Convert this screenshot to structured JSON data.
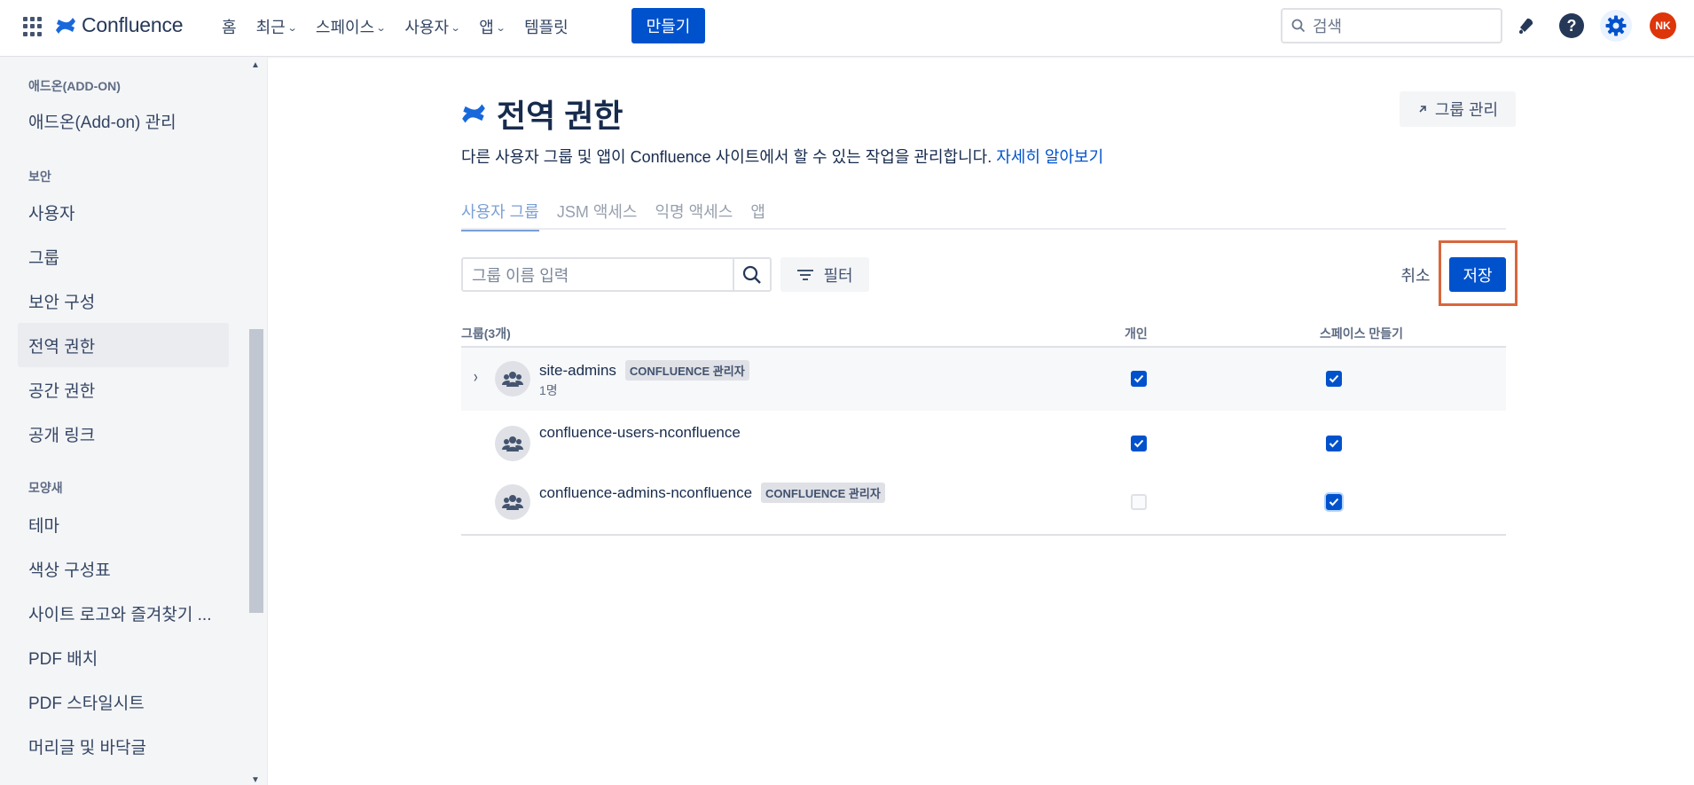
{
  "topnav": {
    "logo_text": "Confluence",
    "items": [
      {
        "label": "홈",
        "dropdown": false
      },
      {
        "label": "최근",
        "dropdown": true
      },
      {
        "label": "스페이스",
        "dropdown": true
      },
      {
        "label": "사용자",
        "dropdown": true
      },
      {
        "label": "앱",
        "dropdown": true
      },
      {
        "label": "템플릿",
        "dropdown": false
      }
    ],
    "create_label": "만들기",
    "search_placeholder": "검색",
    "avatar_initials": "NK"
  },
  "sidebar": {
    "sections": [
      {
        "title": "애드온(ADD-ON)",
        "items": [
          "애드온(Add-on) 관리"
        ]
      },
      {
        "title": "보안",
        "items": [
          "사용자",
          "그룹",
          "보안 구성",
          "전역 권한",
          "공간 권한",
          "공개 링크"
        ]
      },
      {
        "title": "모양새",
        "items": [
          "테마",
          "색상 구성표",
          "사이트 로고와 즐겨찾기 ...",
          "PDF 배치",
          "PDF 스타일시트",
          "머리글 및 바닥글"
        ]
      }
    ],
    "active_item": "전역 권한"
  },
  "main": {
    "title": "전역 권한",
    "manage_groups_label": "그룹 관리",
    "description": "다른 사용자 그룹 및 앱이 Confluence 사이트에서 할 수 있는 작업을 관리합니다.",
    "learn_more": "자세히 알아보기",
    "tabs": [
      "사용자 그룹",
      "JSM 액세스",
      "익명 액세스",
      "앱"
    ],
    "active_tab": "사용자 그룹",
    "filter_placeholder": "그룹 이름 입력",
    "filter_label": "필터",
    "cancel_label": "취소",
    "save_label": "저장",
    "table": {
      "headers": [
        "그룹(3개)",
        "개인",
        "스페이스 만들기"
      ],
      "rows": [
        {
          "name": "site-admins",
          "badge": "CONFLUENCE 관리자",
          "members": "1명",
          "personal": true,
          "create_space": true,
          "expandable": true
        },
        {
          "name": "confluence-users-nconfluence",
          "badge": "",
          "members": "",
          "personal": true,
          "create_space": true,
          "expandable": false
        },
        {
          "name": "confluence-admins-nconfluence",
          "badge": "CONFLUENCE 관리자",
          "members": "",
          "personal": false,
          "create_space": true,
          "expandable": false
        }
      ]
    }
  },
  "colors": {
    "primary": "#0052cc",
    "highlight": "#d9663d",
    "avatar": "#de350b"
  },
  "icons": [
    "app-switcher-icon",
    "confluence-logo-icon",
    "search-icon",
    "notification-bell-icon",
    "help-icon",
    "settings-gear-icon",
    "external-arrow-icon",
    "filter-icon",
    "chevron-right-icon",
    "group-people-icon",
    "checkmark-icon"
  ]
}
